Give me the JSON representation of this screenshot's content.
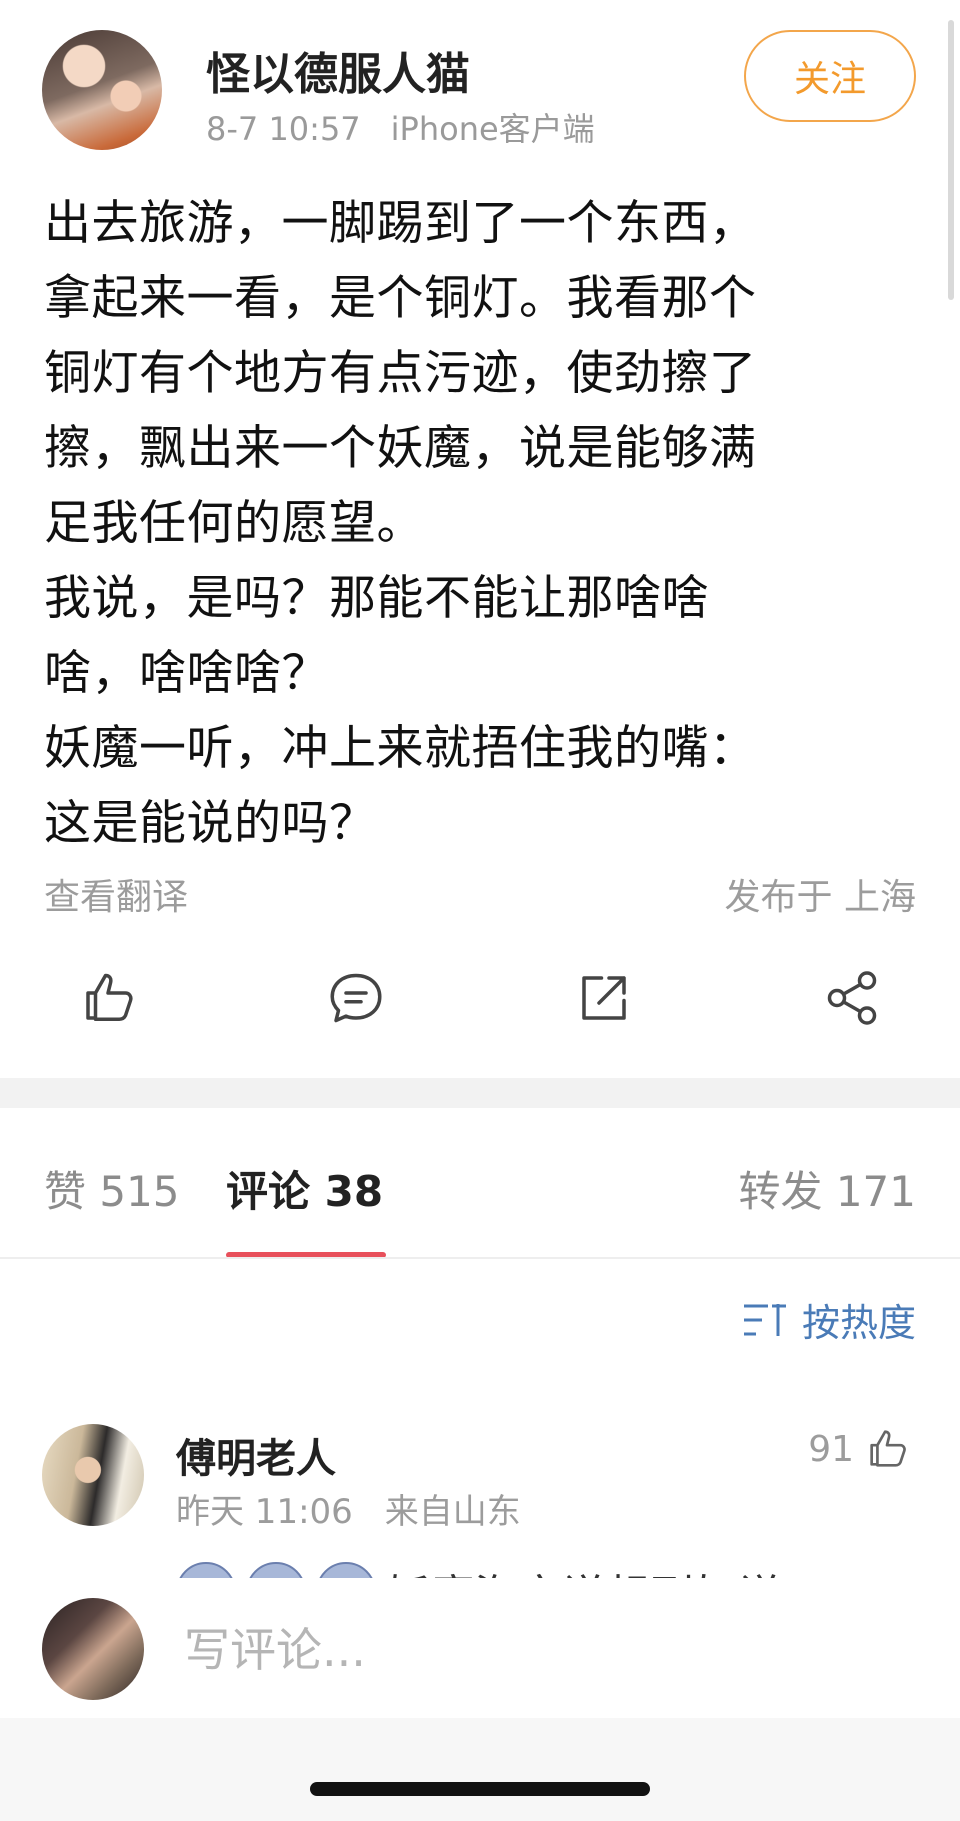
{
  "post": {
    "author": {
      "name": "怪以德服人猫"
    },
    "time": "8-7 10:57",
    "source": "iPhone客户端",
    "follow_label": "关注",
    "content": "出去旅游，一脚踢到了一个东西，\n拿起来一看，是个铜灯。我看那个\n铜灯有个地方有点污迹，使劲擦了\n擦，飘出来一个妖魔，说是能够满\n足我任何的愿望。\n我说，是吗？那能不能让那啥啥\n啥，啥啥啥？\n妖魔一听，冲上来就捂住我的嘴：\n这是能说的吗？",
    "translate_label": "查看翻译",
    "location": "发布于 上海"
  },
  "actions": [
    {
      "name": "like",
      "icon": "thumb-up-icon"
    },
    {
      "name": "comment",
      "icon": "comment-bubble-icon"
    },
    {
      "name": "repost",
      "icon": "repost-icon"
    },
    {
      "name": "share",
      "icon": "share-icon"
    }
  ],
  "tabs": {
    "likes": "赞 515",
    "comments": "评论 38",
    "reposts": "转发 171"
  },
  "sort": {
    "label": "按热度",
    "icon": "sort-icon"
  },
  "comments": [
    {
      "name": "傅明老人",
      "time": "昨天 11:06",
      "location": "来自山东",
      "likes": "91",
      "text": "妖魔海充说想到妇说"
    }
  ],
  "input": {
    "placeholder": "写评论..."
  },
  "colors": {
    "accent_follow": "#f39a2c",
    "tab_indicator": "#e8505b",
    "link_blue": "#4a7bb7"
  }
}
